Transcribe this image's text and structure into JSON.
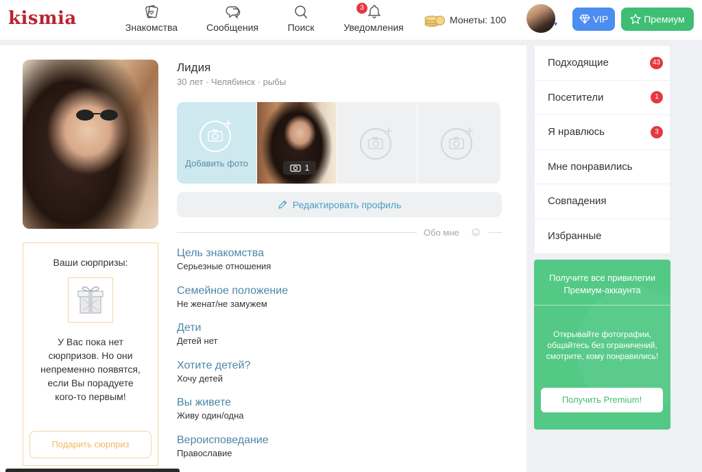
{
  "header": {
    "logo": "kismia",
    "nav": [
      {
        "label": "Знакомства",
        "icon": "cards-icon"
      },
      {
        "label": "Сообщения",
        "icon": "chat-icon"
      },
      {
        "label": "Поиск",
        "icon": "search-icon"
      },
      {
        "label": "Уведомления",
        "icon": "bell-icon",
        "badge": "3"
      }
    ],
    "coins_label": "Монеты: 100",
    "vip_label": "VIP",
    "premium_label": "Премиум"
  },
  "profile": {
    "name": "Лидия",
    "meta": "30 лет · Челябинск · рыбы",
    "add_photo_label": "Добавить фото",
    "photo_count": "1",
    "edit_label": "Редактировать профиль",
    "about_label": "Обо мне",
    "fields": [
      {
        "title": "Цель знакомства",
        "value": "Серьезные отношения"
      },
      {
        "title": "Семейное положение",
        "value": "Не женат/не замужем"
      },
      {
        "title": "Дети",
        "value": "Детей нет"
      },
      {
        "title": "Хотите детей?",
        "value": "Хочу детей"
      },
      {
        "title": "Вы живете",
        "value": "Живу один/одна"
      },
      {
        "title": "Вероисповедание",
        "value": "Православие"
      }
    ]
  },
  "surprises": {
    "title": "Ваши сюрпризы:",
    "text": "У Вас пока нет сюрпризов. Но они непременно появятся, если Вы порадуете кого-то первым!",
    "button": "Подарить сюрприз"
  },
  "sidebar": {
    "items": [
      {
        "label": "Подходящие",
        "badge": "43"
      },
      {
        "label": "Посетители",
        "badge": "1"
      },
      {
        "label": "Я нравлюсь",
        "badge": "3"
      },
      {
        "label": "Мне понравились",
        "badge": ""
      },
      {
        "label": "Совпадения",
        "badge": ""
      },
      {
        "label": "Избранные",
        "badge": ""
      }
    ]
  },
  "promo": {
    "title": "Получите все привилегии Премиум-аккаунта",
    "text": "Открывайте фотографии, общайтесь без ограничений, смотрите, кому понравились!",
    "button": "Получить Premium!"
  },
  "colors": {
    "brand": "#b8242f",
    "accent_blue": "#4b8df0",
    "accent_green": "#3dbe73",
    "link": "#4d86a8",
    "badge": "#e53842",
    "surprise_border": "#f1d59e"
  }
}
